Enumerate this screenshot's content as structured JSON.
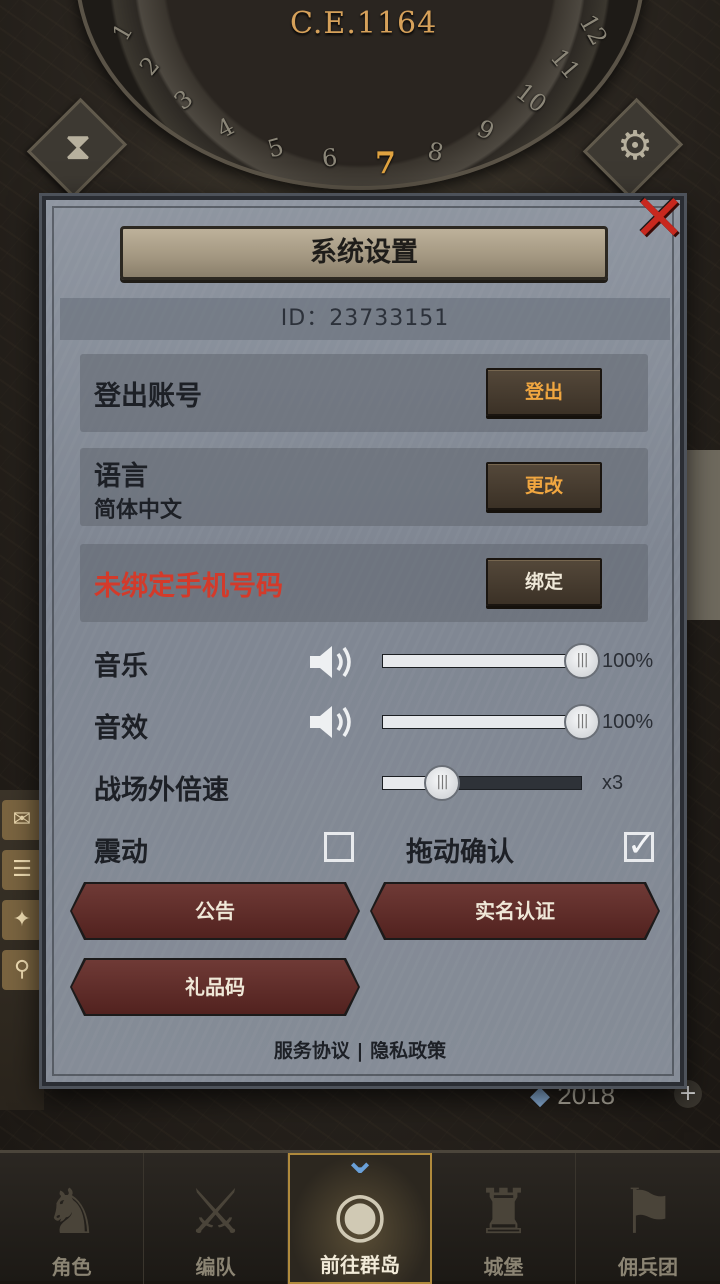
{
  "hud": {
    "year": "C.E.1164",
    "dial_numbers": [
      "1",
      "2",
      "3",
      "4",
      "5",
      "6",
      "7",
      "8",
      "9",
      "10",
      "11",
      "12"
    ],
    "active_dial_number": "7",
    "resource_counter": "2018"
  },
  "dialog": {
    "title": "系统设置",
    "player_id": "ID：23733151",
    "logout": {
      "label": "登出账号",
      "button": "登出"
    },
    "language": {
      "label": "语言",
      "value": "简体中文",
      "button": "更改"
    },
    "phone": {
      "label": "未绑定手机号码",
      "button": "绑定"
    },
    "music": {
      "label": "音乐",
      "value_text": "100%",
      "level": 1.0
    },
    "sfx": {
      "label": "音效",
      "value_text": "100%",
      "level": 1.0
    },
    "battle_speed": {
      "label": "战场外倍速",
      "value_text": "x3",
      "level": 0.3
    },
    "vibration": {
      "label": "震动",
      "checked": false
    },
    "drag_confirm": {
      "label": "拖动确认",
      "checked": true
    },
    "announcement_button": "公告",
    "realname_button": "实名认证",
    "gift_code_button": "礼品码",
    "footer": {
      "service": "服务协议",
      "separator": "|",
      "privacy": "隐私政策"
    }
  },
  "nav": [
    {
      "label": "角色",
      "icon": "knight-icon",
      "glyph": "♞"
    },
    {
      "label": "编队",
      "icon": "helmet-icon",
      "glyph": "⚔"
    },
    {
      "label": "前往群岛",
      "icon": "globe-icon",
      "glyph": "◉"
    },
    {
      "label": "城堡",
      "icon": "castle-icon",
      "glyph": "♜"
    },
    {
      "label": "佣兵团",
      "icon": "banner-icon",
      "glyph": "⚑"
    }
  ],
  "colors": {
    "accent_orange": "#f0a640",
    "warning_red": "#d33a2a",
    "close_red": "#c8281e"
  }
}
